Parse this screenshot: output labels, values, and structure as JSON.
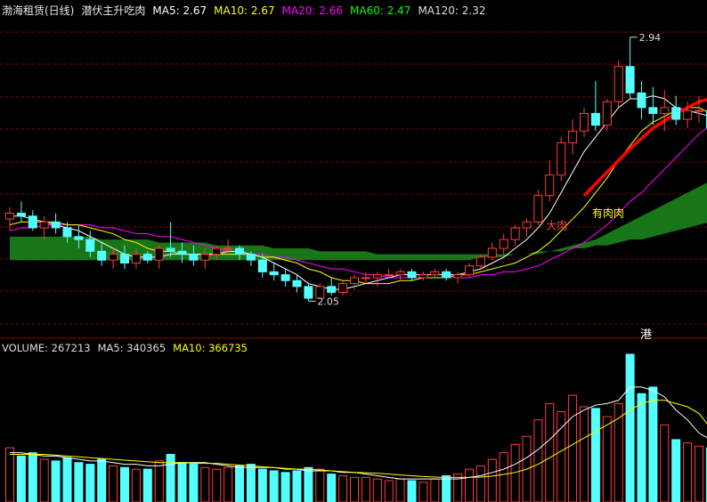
{
  "header": {
    "stock_name": "渤海租赁(日线)",
    "indicator_name": "潜伏主升吃肉",
    "ma_items": [
      {
        "label": "MA5: 2.67",
        "color": "#ffffff"
      },
      {
        "label": "MA10: 2.67",
        "color": "#ffff00"
      },
      {
        "label": "MA20: 2.66",
        "color": "#ff00ff"
      },
      {
        "label": "MA60: 2.47",
        "color": "#00ff00"
      },
      {
        "label": "MA120: 2.32",
        "color": "#dddddd"
      }
    ]
  },
  "volume_header": {
    "items": [
      {
        "label": "VOLUME: 267213",
        "color": "#dddddd"
      },
      {
        "label": "MA5: 340365",
        "color": "#dddddd"
      },
      {
        "label": "MA10: 366735",
        "color": "#ffff00"
      }
    ]
  },
  "annotations": {
    "high_price": "2.94",
    "low_price": "2.05",
    "signal_you_rou": "有肉肉",
    "signal_da_rou": "大肉",
    "gang_marker": "港"
  },
  "colors": {
    "up": "#ff3c3c",
    "down": "#54ffff",
    "grid": "#8b0000",
    "ma5": "#ffffff",
    "ma10": "#ffff00",
    "ma20": "#ff00ff",
    "band": "#1c8a1c",
    "signal": "#ff0000"
  },
  "chart_data": {
    "type": "candlestick",
    "price_ylim": [
      1.95,
      3.0
    ],
    "volume_ylim": [
      0,
      900000
    ],
    "candles": [
      [
        2.32,
        2.36,
        2.28,
        2.34,
        330000
      ],
      [
        2.34,
        2.38,
        2.31,
        2.33,
        280000
      ],
      [
        2.33,
        2.35,
        2.28,
        2.29,
        300000
      ],
      [
        2.29,
        2.33,
        2.25,
        2.31,
        260000
      ],
      [
        2.31,
        2.34,
        2.27,
        2.29,
        250000
      ],
      [
        2.29,
        2.31,
        2.24,
        2.26,
        270000
      ],
      [
        2.26,
        2.3,
        2.22,
        2.25,
        240000
      ],
      [
        2.25,
        2.28,
        2.19,
        2.21,
        230000
      ],
      [
        2.21,
        2.24,
        2.16,
        2.18,
        260000
      ],
      [
        2.18,
        2.22,
        2.15,
        2.2,
        220000
      ],
      [
        2.2,
        2.23,
        2.15,
        2.17,
        210000
      ],
      [
        2.17,
        2.22,
        2.15,
        2.2,
        200000
      ],
      [
        2.2,
        2.21,
        2.17,
        2.18,
        200000
      ],
      [
        2.18,
        2.23,
        2.15,
        2.22,
        250000
      ],
      [
        2.22,
        2.31,
        2.19,
        2.21,
        290000
      ],
      [
        2.21,
        2.24,
        2.17,
        2.2,
        240000
      ],
      [
        2.2,
        2.23,
        2.16,
        2.18,
        230000
      ],
      [
        2.18,
        2.22,
        2.15,
        2.2,
        210000
      ],
      [
        2.2,
        2.23,
        2.18,
        2.22,
        200000
      ],
      [
        2.22,
        2.25,
        2.2,
        2.22,
        210000
      ],
      [
        2.22,
        2.23,
        2.18,
        2.2,
        220000
      ],
      [
        2.2,
        2.21,
        2.16,
        2.18,
        230000
      ],
      [
        2.18,
        2.2,
        2.12,
        2.14,
        200000
      ],
      [
        2.14,
        2.17,
        2.11,
        2.13,
        190000
      ],
      [
        2.13,
        2.15,
        2.09,
        2.11,
        180000
      ],
      [
        2.11,
        2.13,
        2.07,
        2.09,
        190000
      ],
      [
        2.09,
        2.1,
        2.04,
        2.05,
        210000
      ],
      [
        2.05,
        2.1,
        2.05,
        2.09,
        200000
      ],
      [
        2.09,
        2.12,
        2.06,
        2.07,
        170000
      ],
      [
        2.07,
        2.11,
        2.06,
        2.1,
        160000
      ],
      [
        2.1,
        2.13,
        2.08,
        2.12,
        150000
      ],
      [
        2.12,
        2.14,
        2.1,
        2.12,
        150000
      ],
      [
        2.12,
        2.14,
        2.09,
        2.13,
        140000
      ],
      [
        2.13,
        2.15,
        2.12,
        2.13,
        130000
      ],
      [
        2.13,
        2.15,
        2.11,
        2.14,
        140000
      ],
      [
        2.14,
        2.15,
        2.11,
        2.12,
        130000
      ],
      [
        2.12,
        2.14,
        2.11,
        2.13,
        120000
      ],
      [
        2.13,
        2.15,
        2.12,
        2.14,
        140000
      ],
      [
        2.14,
        2.15,
        2.11,
        2.12,
        160000
      ],
      [
        2.12,
        2.14,
        2.1,
        2.13,
        170000
      ],
      [
        2.13,
        2.17,
        2.12,
        2.16,
        200000
      ],
      [
        2.16,
        2.2,
        2.15,
        2.19,
        220000
      ],
      [
        2.19,
        2.24,
        2.18,
        2.22,
        260000
      ],
      [
        2.22,
        2.27,
        2.2,
        2.25,
        300000
      ],
      [
        2.25,
        2.3,
        2.23,
        2.29,
        350000
      ],
      [
        2.29,
        2.32,
        2.26,
        2.31,
        400000
      ],
      [
        2.31,
        2.42,
        2.3,
        2.4,
        500000
      ],
      [
        2.4,
        2.52,
        2.38,
        2.47,
        600000
      ],
      [
        2.47,
        2.6,
        2.45,
        2.58,
        550000
      ],
      [
        2.58,
        2.66,
        2.54,
        2.62,
        650000
      ],
      [
        2.62,
        2.7,
        2.6,
        2.68,
        580000
      ],
      [
        2.68,
        2.79,
        2.62,
        2.64,
        570000
      ],
      [
        2.64,
        2.73,
        2.62,
        2.72,
        520000
      ],
      [
        2.72,
        2.86,
        2.7,
        2.84,
        600000
      ],
      [
        2.84,
        2.94,
        2.73,
        2.75,
        900000
      ],
      [
        2.75,
        2.79,
        2.66,
        2.7,
        660000
      ],
      [
        2.7,
        2.77,
        2.64,
        2.68,
        700000
      ],
      [
        2.68,
        2.76,
        2.62,
        2.7,
        470000
      ],
      [
        2.7,
        2.74,
        2.64,
        2.66,
        380000
      ],
      [
        2.66,
        2.72,
        2.63,
        2.69,
        360000
      ],
      [
        2.69,
        2.74,
        2.65,
        2.69,
        340000
      ],
      [
        2.69,
        2.72,
        2.62,
        2.63,
        330000
      ],
      [
        2.63,
        2.66,
        2.56,
        2.58,
        267213
      ]
    ],
    "ma5": [
      2.33,
      2.33,
      2.32,
      2.31,
      2.3,
      2.29,
      2.28,
      2.26,
      2.24,
      2.22,
      2.2,
      2.19,
      2.19,
      2.19,
      2.2,
      2.2,
      2.2,
      2.2,
      2.2,
      2.21,
      2.21,
      2.2,
      2.19,
      2.17,
      2.15,
      2.13,
      2.1,
      2.09,
      2.08,
      2.08,
      2.09,
      2.1,
      2.11,
      2.12,
      2.13,
      2.13,
      2.13,
      2.13,
      2.13,
      2.13,
      2.14,
      2.15,
      2.17,
      2.19,
      2.22,
      2.25,
      2.29,
      2.34,
      2.41,
      2.48,
      2.55,
      2.6,
      2.65,
      2.7,
      2.73,
      2.73,
      2.74,
      2.73,
      2.7,
      2.69,
      2.68,
      2.67,
      2.67
    ],
    "ma10": [
      2.3,
      2.31,
      2.31,
      2.31,
      2.31,
      2.3,
      2.3,
      2.29,
      2.28,
      2.27,
      2.25,
      2.24,
      2.22,
      2.21,
      2.21,
      2.2,
      2.2,
      2.2,
      2.2,
      2.2,
      2.2,
      2.2,
      2.19,
      2.19,
      2.18,
      2.17,
      2.15,
      2.14,
      2.12,
      2.11,
      2.11,
      2.1,
      2.1,
      2.1,
      2.11,
      2.11,
      2.12,
      2.12,
      2.12,
      2.13,
      2.13,
      2.14,
      2.15,
      2.16,
      2.17,
      2.19,
      2.21,
      2.24,
      2.28,
      2.32,
      2.36,
      2.41,
      2.46,
      2.52,
      2.57,
      2.62,
      2.65,
      2.67,
      2.69,
      2.7,
      2.7,
      2.68,
      2.67
    ],
    "ma20": [
      2.28,
      2.29,
      2.29,
      2.3,
      2.3,
      2.3,
      2.3,
      2.3,
      2.29,
      2.29,
      2.28,
      2.27,
      2.27,
      2.26,
      2.26,
      2.25,
      2.24,
      2.23,
      2.22,
      2.21,
      2.21,
      2.2,
      2.2,
      2.19,
      2.19,
      2.18,
      2.17,
      2.16,
      2.15,
      2.15,
      2.14,
      2.13,
      2.13,
      2.12,
      2.12,
      2.12,
      2.12,
      2.12,
      2.12,
      2.12,
      2.12,
      2.13,
      2.13,
      2.14,
      2.14,
      2.15,
      2.16,
      2.18,
      2.2,
      2.22,
      2.24,
      2.27,
      2.3,
      2.34,
      2.38,
      2.41,
      2.45,
      2.49,
      2.53,
      2.57,
      2.61,
      2.64,
      2.66
    ],
    "band_upper": [
      2.26,
      2.26,
      2.26,
      2.26,
      2.26,
      2.26,
      2.26,
      2.26,
      2.25,
      2.25,
      2.25,
      2.25,
      2.25,
      2.24,
      2.24,
      2.24,
      2.24,
      2.24,
      2.23,
      2.23,
      2.23,
      2.23,
      2.23,
      2.22,
      2.22,
      2.22,
      2.22,
      2.21,
      2.21,
      2.21,
      2.21,
      2.21,
      2.2,
      2.2,
      2.2,
      2.2,
      2.2,
      2.2,
      2.2,
      2.2,
      2.2,
      2.2,
      2.2,
      2.2,
      2.2,
      2.2,
      2.21,
      2.21,
      2.22,
      2.23,
      2.24,
      2.25,
      2.27,
      2.29,
      2.31,
      2.33,
      2.35,
      2.37,
      2.39,
      2.41,
      2.43,
      2.45,
      2.47
    ],
    "band_lower": [
      2.18,
      2.18,
      2.18,
      2.18,
      2.18,
      2.18,
      2.18,
      2.18,
      2.18,
      2.18,
      2.18,
      2.18,
      2.18,
      2.18,
      2.18,
      2.18,
      2.18,
      2.18,
      2.18,
      2.18,
      2.18,
      2.18,
      2.18,
      2.18,
      2.18,
      2.18,
      2.18,
      2.18,
      2.18,
      2.18,
      2.18,
      2.18,
      2.18,
      2.18,
      2.18,
      2.18,
      2.18,
      2.18,
      2.18,
      2.18,
      2.18,
      2.19,
      2.19,
      2.19,
      2.2,
      2.2,
      2.2,
      2.21,
      2.21,
      2.22,
      2.22,
      2.23,
      2.23,
      2.24,
      2.25,
      2.25,
      2.26,
      2.27,
      2.28,
      2.29,
      2.3,
      2.31,
      2.32
    ],
    "thick_red_line": [
      [
        50,
        2.4
      ],
      [
        52,
        2.48
      ],
      [
        54,
        2.56
      ],
      [
        56,
        2.63
      ],
      [
        58,
        2.68
      ],
      [
        60,
        2.72
      ],
      [
        62,
        2.74
      ]
    ],
    "vol_ma5": [
      300000,
      300000,
      290000,
      280000,
      280000,
      270000,
      260000,
      250000,
      250000,
      240000,
      230000,
      230000,
      220000,
      220000,
      230000,
      240000,
      240000,
      240000,
      230000,
      220000,
      210000,
      210000,
      210000,
      210000,
      200000,
      200000,
      190000,
      190000,
      190000,
      180000,
      180000,
      170000,
      160000,
      150000,
      140000,
      140000,
      140000,
      140000,
      140000,
      140000,
      150000,
      160000,
      180000,
      200000,
      230000,
      270000,
      320000,
      380000,
      450000,
      520000,
      560000,
      590000,
      600000,
      620000,
      700000,
      700000,
      680000,
      640000,
      560000,
      500000,
      420000,
      380000,
      340365
    ],
    "vol_ma10": [
      290000,
      290000,
      290000,
      290000,
      285000,
      280000,
      275000,
      270000,
      265000,
      260000,
      255000,
      250000,
      245000,
      240000,
      240000,
      240000,
      235000,
      235000,
      235000,
      230000,
      225000,
      220000,
      215000,
      210000,
      205000,
      200000,
      200000,
      195000,
      190000,
      185000,
      180000,
      178000,
      175000,
      170000,
      165000,
      160000,
      155000,
      152000,
      150000,
      150000,
      150000,
      152000,
      158000,
      168000,
      180000,
      200000,
      230000,
      270000,
      310000,
      350000,
      390000,
      430000,
      470000,
      510000,
      560000,
      600000,
      620000,
      620000,
      600000,
      580000,
      540000,
      450000,
      366735
    ]
  }
}
